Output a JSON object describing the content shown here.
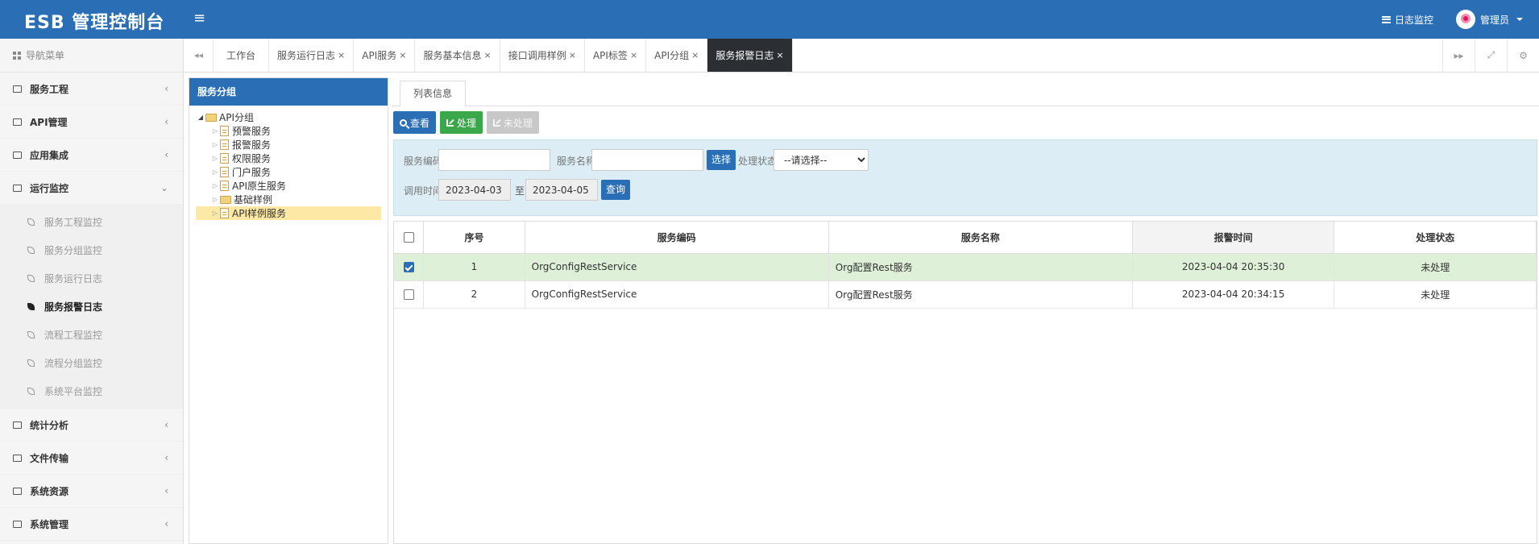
{
  "header": {
    "brand": "ESB 管理控制台",
    "menu_toggle": "≡",
    "log_monitor": "日志监控",
    "user_name": "管理员"
  },
  "sidebar": {
    "title": "导航菜单",
    "groups": [
      {
        "label": "服务工程",
        "chevron": "‹"
      },
      {
        "label": "API管理",
        "chevron": "‹"
      },
      {
        "label": "应用集成",
        "chevron": "‹"
      },
      {
        "label": "运行监控",
        "chevron": "⌄"
      },
      {
        "label": "统计分析",
        "chevron": "‹"
      },
      {
        "label": "文件传输",
        "chevron": "‹"
      },
      {
        "label": "系统资源",
        "chevron": "‹"
      },
      {
        "label": "系统管理",
        "chevron": "‹"
      }
    ],
    "monitor_items": [
      "服务工程监控",
      "服务分组监控",
      "服务运行日志",
      "服务报警日志",
      "流程工程监控",
      "流程分组监控",
      "系统平台监控"
    ],
    "active_item": "服务报警日志"
  },
  "tabs": {
    "prev": "◂◂",
    "items": [
      {
        "label": "工作台",
        "closable": false
      },
      {
        "label": "服务运行日志",
        "closable": true
      },
      {
        "label": "API服务",
        "closable": true
      },
      {
        "label": "服务基本信息",
        "closable": true
      },
      {
        "label": "接口调用样例",
        "closable": true
      },
      {
        "label": "API标签",
        "closable": true
      },
      {
        "label": "API分组",
        "closable": true
      },
      {
        "label": "服务报警日志",
        "closable": true
      }
    ],
    "close_glyph": "×",
    "next": "▸▸",
    "fullscreen": "⤢",
    "settings": "⚙"
  },
  "tree": {
    "header": "服务分组",
    "root": "API分组",
    "children": [
      {
        "label": "预警服务",
        "type": "file"
      },
      {
        "label": "报警服务",
        "type": "file"
      },
      {
        "label": "权限服务",
        "type": "file"
      },
      {
        "label": "门户服务",
        "type": "file"
      },
      {
        "label": "API原生服务",
        "type": "file"
      },
      {
        "label": "基础样例",
        "type": "folder"
      },
      {
        "label": "API样例服务",
        "type": "file"
      }
    ],
    "selected": "API样例服务"
  },
  "content": {
    "tab_label": "列表信息",
    "toolbar": {
      "view": "查看",
      "process": "处理",
      "unprocess": "未处理"
    },
    "search": {
      "service_code_label": "服务编码",
      "service_code_value": "",
      "service_name_label": "服务名称",
      "service_name_value": "",
      "select_btn": "选择",
      "status_label": "处理状态",
      "status_selected": "--请选择--",
      "time_label": "调用时间",
      "date_from": "2023-04-03",
      "date_sep": "至",
      "date_to": "2023-04-05",
      "query_btn": "查询"
    },
    "table": {
      "columns": [
        "序号",
        "服务编码",
        "服务名称",
        "报警时间",
        "处理状态"
      ],
      "rows": [
        {
          "checked": true,
          "no": "1",
          "code": "OrgConfigRestService",
          "name": "Org配置Rest服务",
          "time": "2023-04-04 20:35:30",
          "status": "未处理"
        },
        {
          "checked": false,
          "no": "2",
          "code": "OrgConfigRestService",
          "name": "Org配置Rest服务",
          "time": "2023-04-04 20:34:15",
          "status": "未处理"
        }
      ]
    }
  },
  "colors": {
    "primary": "#2a6fb6",
    "success": "#3aa84a",
    "active_tab": "#2b2f33",
    "search_bg": "#dcedf5",
    "row_selected": "#dff0d8",
    "tree_selected": "#fde8a6"
  }
}
